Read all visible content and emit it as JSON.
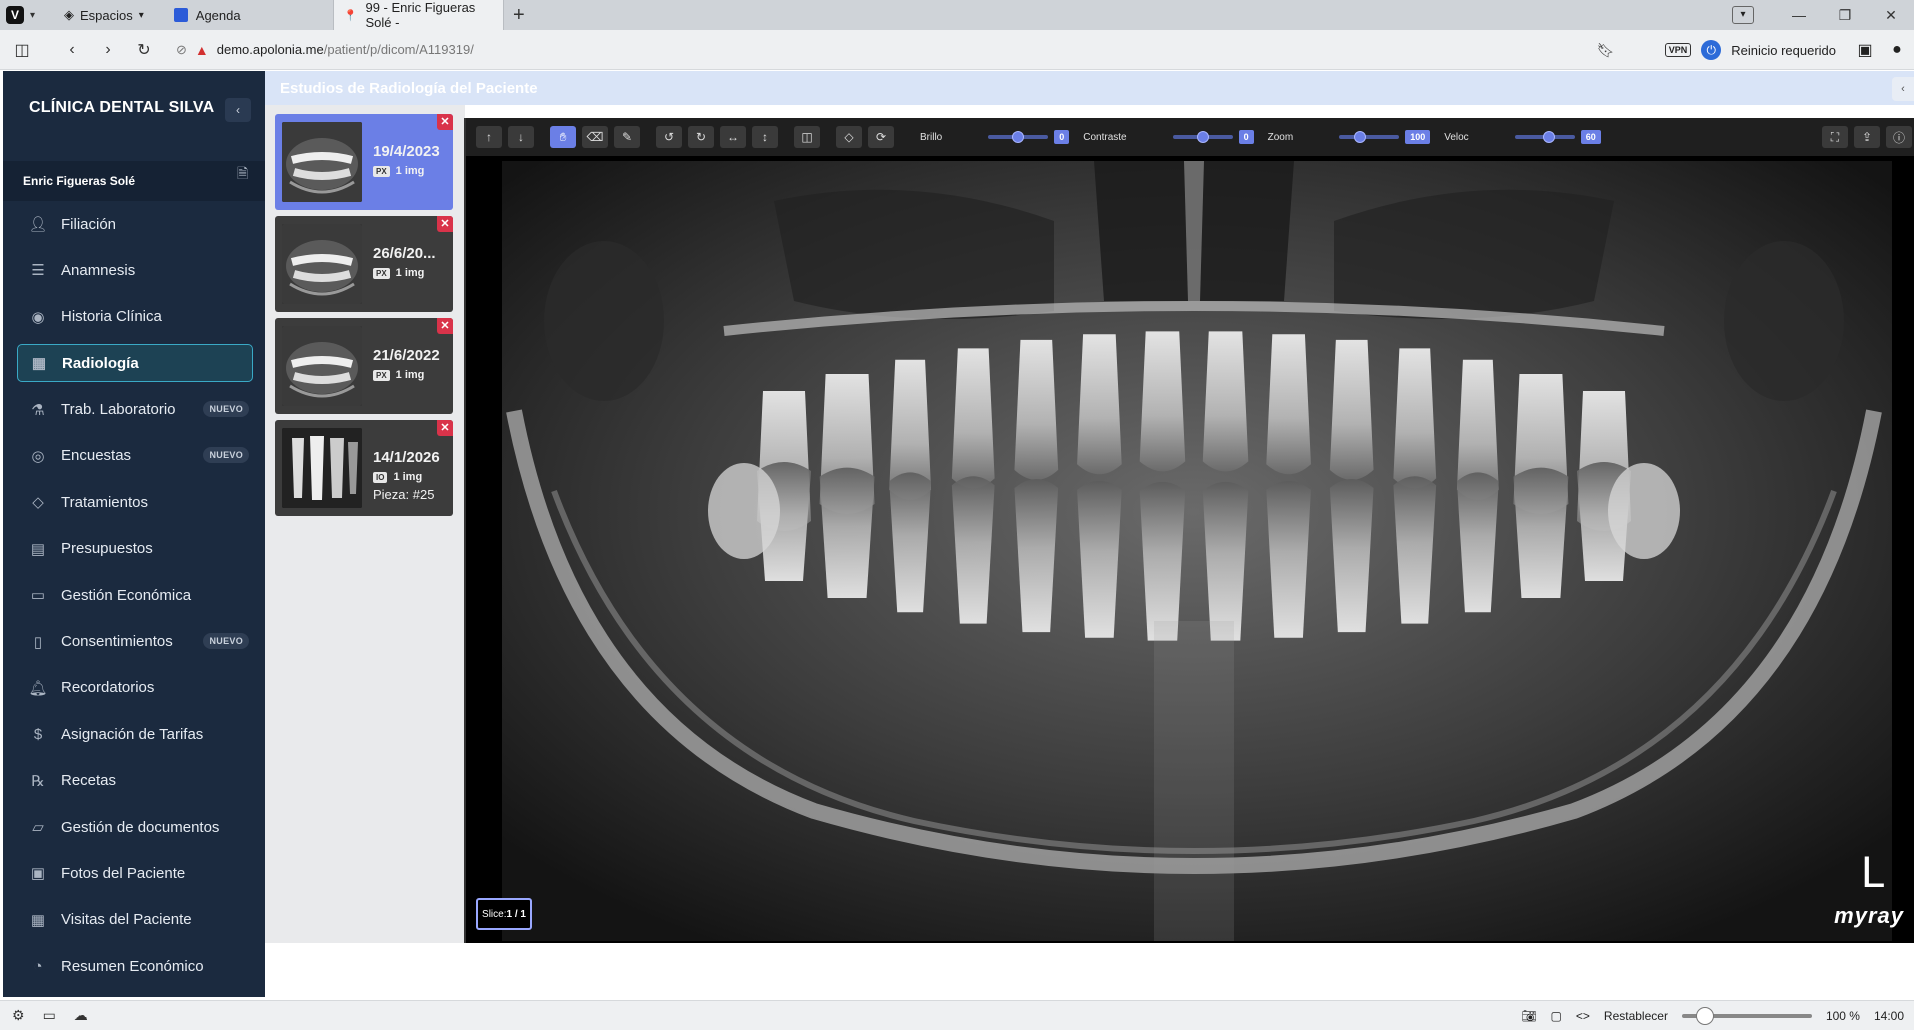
{
  "browser": {
    "spaces_label": "Espacios",
    "tabs": [
      {
        "title": "Agenda",
        "active": false
      },
      {
        "title": "99 - Enric Figueras Solé -",
        "active": true
      }
    ],
    "url_host": "demo.apolonia.me",
    "url_path": "/patient/p/dicom/A119319/",
    "vpn_label": "VPN",
    "restart_label": "Reinicio requerido"
  },
  "sidebar": {
    "brand": "CLÍNICA DENTAL SILVA",
    "patient_name": "Enric Figueras Solé",
    "items": [
      {
        "label": "Filiación",
        "icon": "user-icon",
        "active": false,
        "badge": ""
      },
      {
        "label": "Anamnesis",
        "icon": "list-icon",
        "active": false,
        "badge": ""
      },
      {
        "label": "Historia Clínica",
        "icon": "person-circle-icon",
        "active": false,
        "badge": ""
      },
      {
        "label": "Radiología",
        "icon": "xray-icon",
        "active": true,
        "badge": ""
      },
      {
        "label": "Trab. Laboratorio",
        "icon": "lab-icon",
        "active": false,
        "badge": "NUEVO"
      },
      {
        "label": "Encuestas",
        "icon": "survey-icon",
        "active": false,
        "badge": "NUEVO"
      },
      {
        "label": "Tratamientos",
        "icon": "tag-icon",
        "active": false,
        "badge": ""
      },
      {
        "label": "Presupuestos",
        "icon": "budget-icon",
        "active": false,
        "badge": ""
      },
      {
        "label": "Gestión Económica",
        "icon": "wallet-icon",
        "active": false,
        "badge": ""
      },
      {
        "label": "Consentimientos",
        "icon": "book-icon",
        "active": false,
        "badge": "NUEVO"
      },
      {
        "label": "Recordatorios",
        "icon": "bell-icon",
        "active": false,
        "badge": ""
      },
      {
        "label": "Asignación de Tarifas",
        "icon": "tariff-icon",
        "active": false,
        "badge": ""
      },
      {
        "label": "Recetas",
        "icon": "prescription-icon",
        "active": false,
        "badge": ""
      },
      {
        "label": "Gestión de documentos",
        "icon": "folder-icon",
        "active": false,
        "badge": ""
      },
      {
        "label": "Fotos del Paciente",
        "icon": "photo-icon",
        "active": false,
        "badge": ""
      },
      {
        "label": "Visitas del Paciente",
        "icon": "calendar-icon",
        "active": false,
        "badge": ""
      },
      {
        "label": "Resumen Económico",
        "icon": "chart-icon",
        "active": false,
        "badge": ""
      }
    ]
  },
  "main": {
    "title": "Estudios de Radiología del Paciente"
  },
  "studies": [
    {
      "date": "19/4/2023",
      "modality": "PX",
      "count": "1 img",
      "pieza": "",
      "selected": true
    },
    {
      "date": "26/6/20...",
      "modality": "PX",
      "count": "1 img",
      "pieza": "",
      "selected": false
    },
    {
      "date": "21/6/2022",
      "modality": "PX",
      "count": "1 img",
      "pieza": "",
      "selected": false
    },
    {
      "date": "14/1/2026",
      "modality": "IO",
      "count": "1 img",
      "pieza": "Pieza: #25",
      "selected": false
    }
  ],
  "viewer": {
    "controls": [
      {
        "label": "Brillo",
        "value": "0",
        "level": 0.5
      },
      {
        "label": "Contraste",
        "value": "0",
        "level": 0.5
      },
      {
        "label": "Zoom",
        "value": "100",
        "level": 0.3
      },
      {
        "label": "Veloc",
        "value": "60",
        "level": 0.6
      }
    ],
    "slice_label": "Slice:",
    "slice_value": "1 / 1",
    "orientation": "L",
    "logo": "myray"
  },
  "statusbar": {
    "reset_label": "Restablecer",
    "zoom": "100 %",
    "time": "14:00"
  }
}
